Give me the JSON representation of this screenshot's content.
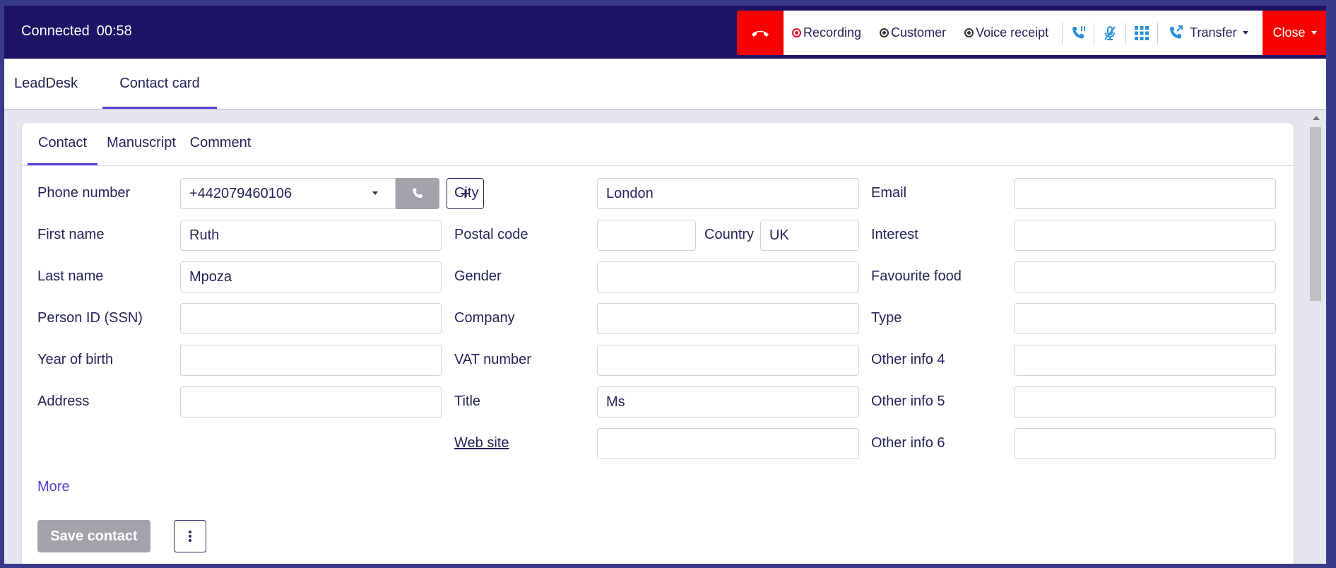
{
  "call_bar": {
    "status": "Connected",
    "timer": "00:58",
    "controls": [
      {
        "label": "Recording",
        "indicator": "red"
      },
      {
        "label": "Customer",
        "indicator": "dark"
      },
      {
        "label": "Voice receipt",
        "indicator": "dark"
      }
    ],
    "icons": [
      "hold-call-icon",
      "mute-microphone-icon",
      "dialpad-icon"
    ],
    "transfer_label": "Transfer",
    "close_label": "Close",
    "colors": {
      "bar": "#1c1465",
      "danger": "#f80000",
      "accent_icon": "#2a8fd8"
    }
  },
  "main_tabs": [
    {
      "label": "LeadDesk",
      "active": false
    },
    {
      "label": "Contact card",
      "active": true
    }
  ],
  "sub_tabs": [
    {
      "label": "Contact",
      "active": true
    },
    {
      "label": "Manuscript",
      "active": false
    },
    {
      "label": "Comment",
      "active": false
    }
  ],
  "form": {
    "col1": [
      {
        "label": "Phone number",
        "value": "+442079460106"
      },
      {
        "label": "First name",
        "value": "Ruth"
      },
      {
        "label": "Last name",
        "value": "Mpoza"
      },
      {
        "label": "Person ID (SSN)",
        "value": ""
      },
      {
        "label": "Year of birth",
        "value": ""
      },
      {
        "label": "Address",
        "value": ""
      }
    ],
    "col2": [
      {
        "label": "City",
        "value": "London"
      },
      {
        "label": "Postal code",
        "value": ""
      },
      {
        "label": "Gender",
        "value": ""
      },
      {
        "label": "Company",
        "value": ""
      },
      {
        "label": "VAT number",
        "value": ""
      },
      {
        "label": "Title",
        "value": "Ms"
      },
      {
        "label": "Web site",
        "value": ""
      }
    ],
    "country": {
      "label": "Country",
      "value": "UK"
    },
    "col3": [
      {
        "label": "Email",
        "value": ""
      },
      {
        "label": "Interest",
        "value": ""
      },
      {
        "label": "Favourite food",
        "value": ""
      },
      {
        "label": "Type",
        "value": ""
      },
      {
        "label": "Other info 4",
        "value": ""
      },
      {
        "label": "Other info 5",
        "value": ""
      },
      {
        "label": "Other info 6",
        "value": ""
      }
    ]
  },
  "actions": {
    "more_label": "More",
    "save_label": "Save contact",
    "add_symbol": "+"
  }
}
